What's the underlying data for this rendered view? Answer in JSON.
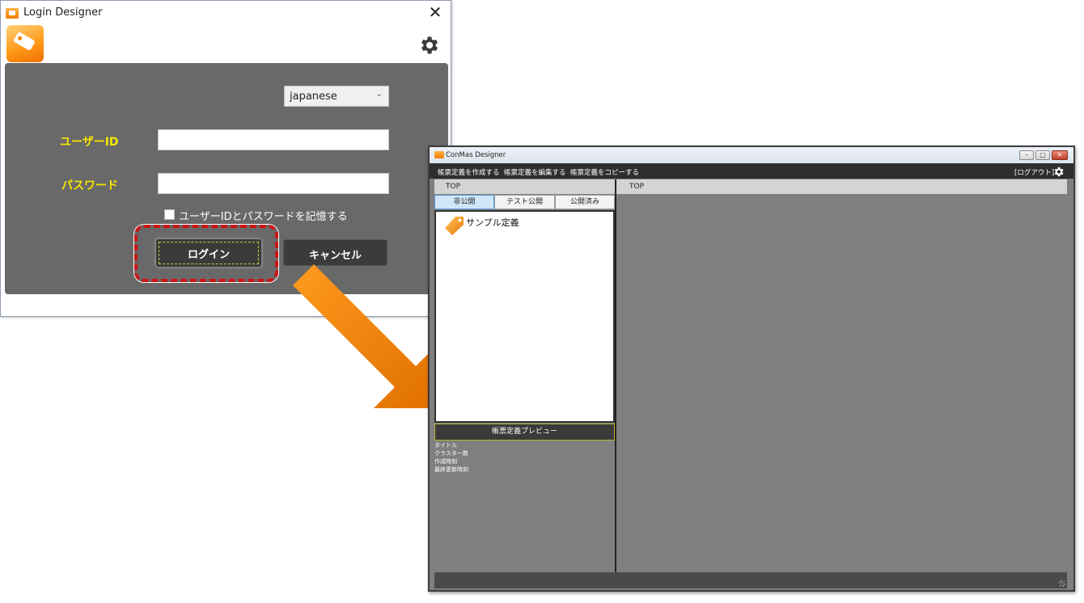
{
  "login_window": {
    "title": "Login Designer",
    "close_glyph": "✕",
    "language": {
      "selected": "japanese",
      "chevron": "⌄"
    },
    "user_id_label": "ユーザーID",
    "user_id_value": "",
    "password_label": "パスワード",
    "password_value": "",
    "remember_label": "ユーザーIDとパスワードを記憶する",
    "remember_checked": false,
    "login_button": "ログイン",
    "cancel_button": "キャンセル",
    "highlight_color": "#cc1515",
    "label_color": "#f5e600"
  },
  "arrow_color": "#f08a00",
  "designer_window": {
    "title": "ConMas Designer",
    "menu": [
      "帳票定義を作成する",
      "帳票定義を編集する",
      "帳票定義をコピーする"
    ],
    "logout": "[ログアウト]",
    "left_header": "TOP",
    "tabs": [
      {
        "label": "非公開",
        "active": true
      },
      {
        "label": "テスト公開",
        "active": false
      },
      {
        "label": "公開済み",
        "active": false
      }
    ],
    "definitions": [
      "サンプル定義"
    ],
    "preview_title": "帳票定義プレビュー",
    "preview_fields": [
      "タイトル",
      "クラスター数",
      "作成時刻",
      "最終更新時刻"
    ],
    "right_header": "TOP",
    "controls": {
      "minimize": "–",
      "maximize": "□",
      "close": "✕"
    }
  }
}
